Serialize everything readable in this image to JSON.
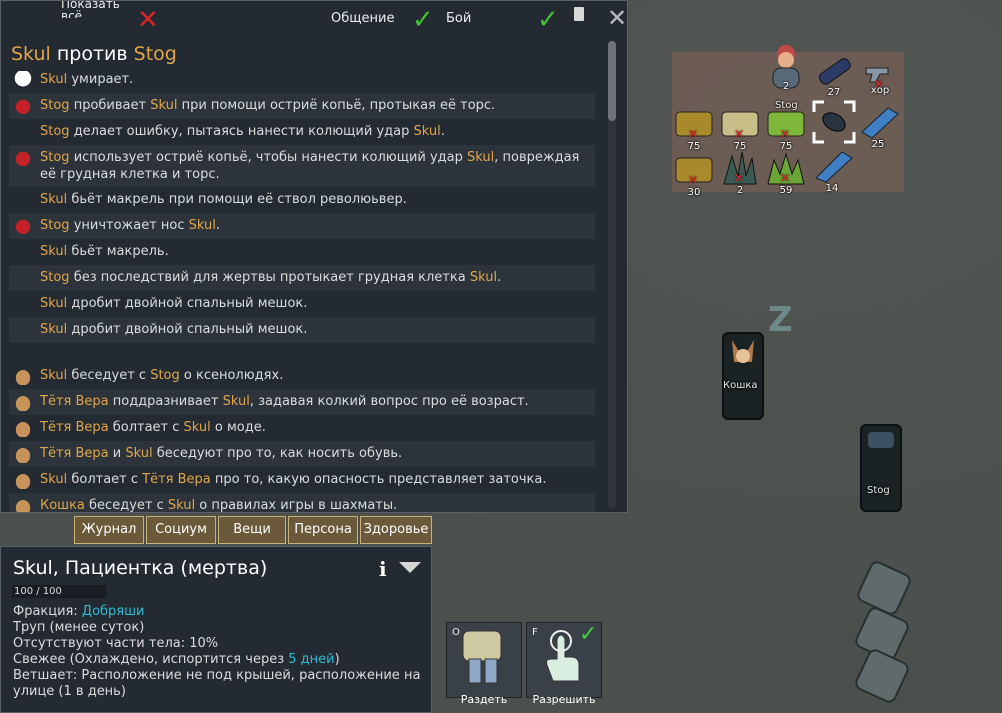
{
  "colors": {
    "pawn_name": "#e0a64b",
    "faction": "#2dbcd6",
    "ok": "#43c033",
    "bad": "#d8232a"
  },
  "log": {
    "filters": {
      "show_all": "Показать всё",
      "social": "Общение",
      "combat": "Бой"
    },
    "title_a": "Skul",
    "title_vs": "против",
    "title_b": "Stog",
    "entries": [
      {
        "icon": "skull-icon",
        "parts": [
          [
            "n",
            "Skul"
          ],
          [
            "t",
            " умирает."
          ]
        ]
      },
      {
        "icon": "blood-icon",
        "parts": [
          [
            "n",
            "Stog"
          ],
          [
            "t",
            " пробивает "
          ],
          [
            "n",
            "Skul"
          ],
          [
            "t",
            " при помощи остриё копьё, протыкая её торс."
          ]
        ]
      },
      {
        "icon": "",
        "parts": [
          [
            "n",
            "Stog"
          ],
          [
            "t",
            " делает ошибку, пытаясь нанести колющий удар "
          ],
          [
            "n",
            "Skul"
          ],
          [
            "t",
            "."
          ]
        ]
      },
      {
        "icon": "blood-icon",
        "parts": [
          [
            "n",
            "Stog"
          ],
          [
            "t",
            " использует остриё копьё, чтобы нанести колющий удар "
          ],
          [
            "n",
            "Skul"
          ],
          [
            "t",
            ", повреждая её грудная клетка и торс."
          ]
        ]
      },
      {
        "icon": "",
        "parts": [
          [
            "n",
            "Skul"
          ],
          [
            "t",
            " бьёт макрель при помощи её ствол революьвер."
          ]
        ]
      },
      {
        "icon": "blood-icon",
        "parts": [
          [
            "n",
            "Stog"
          ],
          [
            "t",
            " уничтожает нос "
          ],
          [
            "n",
            "Skul"
          ],
          [
            "t",
            "."
          ]
        ]
      },
      {
        "icon": "",
        "parts": [
          [
            "n",
            "Skul"
          ],
          [
            "t",
            " бьёт макрель."
          ]
        ]
      },
      {
        "icon": "",
        "parts": [
          [
            "n",
            "Stog"
          ],
          [
            "t",
            " без последствий для жертвы протыкает грудная клетка "
          ],
          [
            "n",
            "Skul"
          ],
          [
            "t",
            "."
          ]
        ]
      },
      {
        "icon": "",
        "parts": [
          [
            "n",
            "Skul"
          ],
          [
            "t",
            " дробит двойной спальный мешок."
          ]
        ]
      },
      {
        "icon": "",
        "parts": [
          [
            "n",
            "Skul"
          ],
          [
            "t",
            " дробит двойной спальный мешок."
          ]
        ]
      },
      {
        "gap": true
      },
      {
        "icon": "hand-icon",
        "parts": [
          [
            "n",
            "Skul"
          ],
          [
            "t",
            " беседует с "
          ],
          [
            "n",
            "Stog"
          ],
          [
            "t",
            " о ксенолюдях."
          ]
        ]
      },
      {
        "icon": "hand-down-icon",
        "parts": [
          [
            "n",
            "Тётя Вера"
          ],
          [
            "t",
            " поддразнивает "
          ],
          [
            "n",
            "Skul"
          ],
          [
            "t",
            ", задавая колкий вопрос про её возраст."
          ]
        ]
      },
      {
        "icon": "hand-icon",
        "parts": [
          [
            "n",
            "Тётя Вера"
          ],
          [
            "t",
            " болтает с "
          ],
          [
            "n",
            "Skul"
          ],
          [
            "t",
            " о моде."
          ]
        ]
      },
      {
        "icon": "hand-icon",
        "parts": [
          [
            "n",
            "Тётя Вера"
          ],
          [
            "t",
            " и "
          ],
          [
            "n",
            "Skul"
          ],
          [
            "t",
            " беседуют про то, как носить обувь."
          ]
        ]
      },
      {
        "icon": "hand-icon",
        "parts": [
          [
            "n",
            "Skul"
          ],
          [
            "t",
            " болтает с "
          ],
          [
            "n",
            "Тётя Вера"
          ],
          [
            "t",
            " про то, какую опасность представляет заточка."
          ]
        ]
      },
      {
        "icon": "hand-icon",
        "parts": [
          [
            "n",
            "Кошка"
          ],
          [
            "t",
            " беседует с "
          ],
          [
            "n",
            "Skul"
          ],
          [
            "t",
            " о правилах игры в шахматы."
          ]
        ]
      }
    ]
  },
  "tabs": [
    "Журнал",
    "Социум",
    "Вещи",
    "Персона",
    "Здоровье"
  ],
  "inspect": {
    "title": "Skul, Пациентка (мертва)",
    "hp": "100 / 100",
    "faction_label": "Фракция: ",
    "faction": "Добряши",
    "line_corpse": "Труп (менее суток)",
    "line_missing": "Отсутствуют части тела: 10%",
    "fresh_pre": "Свежее (Охлаждено, испортится через ",
    "fresh_days": "5 дней",
    "fresh_post": ")",
    "line_decay1": "Ветшает: Расположение не под крышей, расположение на",
    "line_decay2": "улице (1 в день)"
  },
  "gizmos": [
    {
      "hotkey": "O",
      "label": "Раздеть",
      "icon": "strip-icon"
    },
    {
      "hotkey": "F",
      "label": "Разрешить",
      "icon": "allow-hand-icon"
    }
  ],
  "world": {
    "items": [
      {
        "label": "2",
        "sub": "Stog",
        "icon": "pawn-icon"
      },
      {
        "label": "27",
        "icon": "pack-icon"
      },
      {
        "label": "хор",
        "icon": "revolver-icon"
      },
      {
        "label": "75",
        "icon": "hay-icon"
      },
      {
        "label": "75",
        "icon": "hay-icon"
      },
      {
        "label": "75",
        "icon": "hay-icon"
      },
      {
        "label": "",
        "icon": "selected-item-icon"
      },
      {
        "label": "25",
        "icon": "fish-icon"
      },
      {
        "label": "30",
        "icon": "hay-icon"
      },
      {
        "label": "2",
        "icon": "agave-icon"
      },
      {
        "label": "59",
        "icon": "herb-icon"
      },
      {
        "label": "14",
        "icon": "fish-icon"
      }
    ],
    "bed_cat": "Кошка",
    "bed_stog": "Stog",
    "sleep": "Z"
  }
}
